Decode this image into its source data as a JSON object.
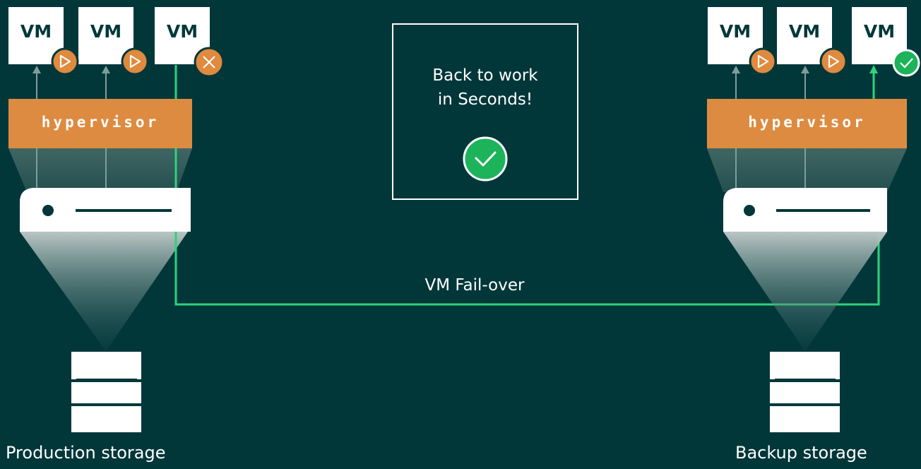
{
  "production": {
    "vms": [
      {
        "label": "VM",
        "status": "running"
      },
      {
        "label": "VM",
        "status": "running"
      },
      {
        "label": "VM",
        "status": "failed"
      }
    ],
    "hypervisor_label": "hypervisor",
    "storage_label": "Production storage"
  },
  "backup": {
    "vms": [
      {
        "label": "VM",
        "status": "running"
      },
      {
        "label": "VM",
        "status": "running"
      },
      {
        "label": "VM",
        "status": "recovered"
      }
    ],
    "hypervisor_label": "hypervisor",
    "storage_label": "Backup storage"
  },
  "callout": {
    "line1": "Back to work",
    "line2": "in Seconds!"
  },
  "failover_label": "VM Fail-over",
  "colors": {
    "background": "#02373a",
    "hypervisor": "#dd8b41",
    "status_orange": "#df8a3e",
    "accent_green": "#2ed37b",
    "check_green": "#1cb35a",
    "vm_text": "#01383b"
  },
  "icons": {
    "running": "play-icon",
    "failed": "x-icon",
    "recovered": "check-icon",
    "callout": "check-circle-icon"
  }
}
